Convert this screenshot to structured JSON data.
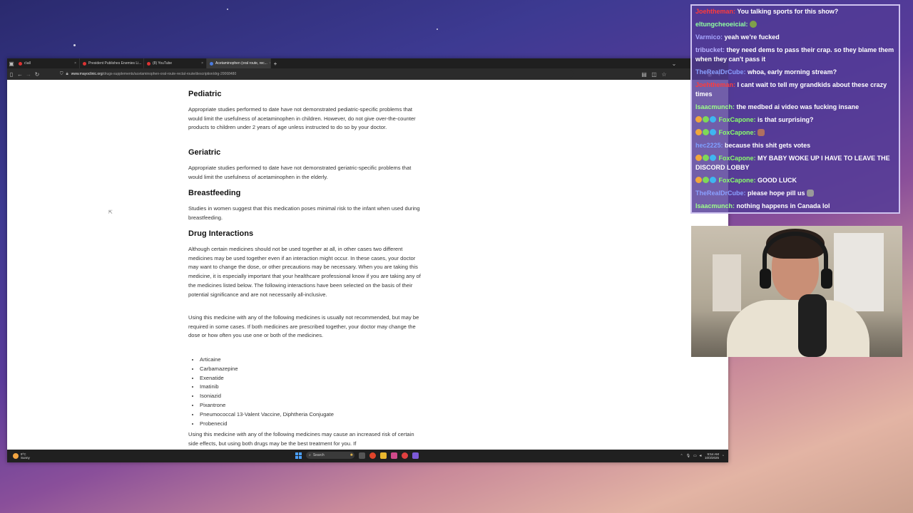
{
  "browser": {
    "tabs": [
      {
        "label": "c\\all",
        "active": false,
        "favicon": "twitch-icon"
      },
      {
        "label": "President Publishes Enemies Li...",
        "active": false,
        "favicon": "page-icon"
      },
      {
        "label": "(8) YouTube",
        "active": false,
        "favicon": "youtube-icon"
      },
      {
        "label": "Acetaminophen (oral route, rec...",
        "active": true,
        "favicon": "mayo-icon"
      }
    ],
    "url_domain": "www.mayoclinic.org",
    "url_path": "/drugs-supplements/acetaminophen-oral-route-rectal-route/description/drg-20068480"
  },
  "article": {
    "pediatric_heading": "Pediatric",
    "pediatric_text": "Appropriate studies performed to date have not demonstrated pediatric-specific problems that would limit the usefulness of acetaminophen in children. However, do not give over-the-counter products to children under 2 years of age unless instructed to do so by your doctor.",
    "geriatric_heading": "Geriatric",
    "geriatric_text": "Appropriate studies performed to date have not demonstrated geriatric-specific problems that would limit the usefulness of acetaminophen in the elderly.",
    "breastfeeding_heading": "Breastfeeding",
    "breastfeeding_text": "Studies in women suggest that this medication poses minimal risk to the infant when used during breastfeeding.",
    "interactions_heading": "Drug Interactions",
    "interactions_text_1": "Although certain medicines should not be used together at all, in other cases two different medicines may be used together even if an interaction might occur. In these cases, your doctor may want to change the dose, or other precautions may be necessary. When you are taking this medicine, it is especially important that your healthcare professional know if you are taking any of the medicines listed below. The following interactions have been selected on the basis of their potential significance and are not necessarily all-inclusive.",
    "interactions_text_2": "Using this medicine with any of the following medicines is usually not recommended, but may be required in some cases. If both medicines are prescribed together, your doctor may change the dose or how often you use one or both of the medicines.",
    "drug_list": [
      "Articaine",
      "Carbamazepine",
      "Exenatide",
      "Imatinib",
      "Isoniazid",
      "Pixantrone",
      "Pneumococcal 13-Valent Vaccine, Diphtheria Conjugate",
      "Probenecid"
    ],
    "interactions_text_3": "Using this medicine with any of the following medicines may cause an increased risk of certain side effects, but using both drugs may be the best treatment for you. If"
  },
  "taskbar": {
    "weather_temp": "9°C",
    "weather_desc": "Sunny",
    "search_placeholder": "Search",
    "time": "9:54 AM",
    "date": "10/3/2025"
  },
  "chat": {
    "messages": [
      {
        "user": "Joehtheman:",
        "user_color": "#ff3b3b",
        "text": "You talking sports for this show?"
      },
      {
        "user": "eltungcheoeicial:",
        "user_color": "#8fffa0",
        "text": ""
      },
      {
        "user": "Varmico:",
        "user_color": "#a7a7ff",
        "text": "yeah we're fucked"
      },
      {
        "user": "tribucket:",
        "user_color": "#b9b3ff",
        "text": "they need dems to pass their crap. so they blame them when they can't pass it"
      },
      {
        "user": "TheRealDrCube:",
        "user_color": "#8aa0ff",
        "text": "whoa, early morning stream?"
      },
      {
        "user": "Joehtheman:",
        "user_color": "#ff3b3b",
        "text": "I cant wait to tell my grandkids about these crazy times"
      },
      {
        "user": "Isaacmunch:",
        "user_color": "#9dff8a",
        "text": "the medbed ai video was fucking insane"
      },
      {
        "user": "FoxCapone:",
        "user_color": "#8aff6b",
        "text": "is that surprising?"
      },
      {
        "user": "FoxCapone:",
        "user_color": "#8aff6b",
        "text": ""
      },
      {
        "user": "hec2225:",
        "user_color": "#7f9fff",
        "text": "because this shit gets votes"
      },
      {
        "user": "FoxCapone:",
        "user_color": "#8aff6b",
        "text": "MY BABY WOKE UP I HAVE TO LEAVE THE DISCORD LOBBY"
      },
      {
        "user": "FoxCapone:",
        "user_color": "#8aff6b",
        "text": "GOOD LUCK"
      },
      {
        "user": "TheRealDrCube:",
        "user_color": "#8aa0ff",
        "text": "please hope pill us"
      },
      {
        "user": "Isaacmunch:",
        "user_color": "#9dff8a",
        "text": "nothing happens in Canada lol"
      }
    ]
  }
}
